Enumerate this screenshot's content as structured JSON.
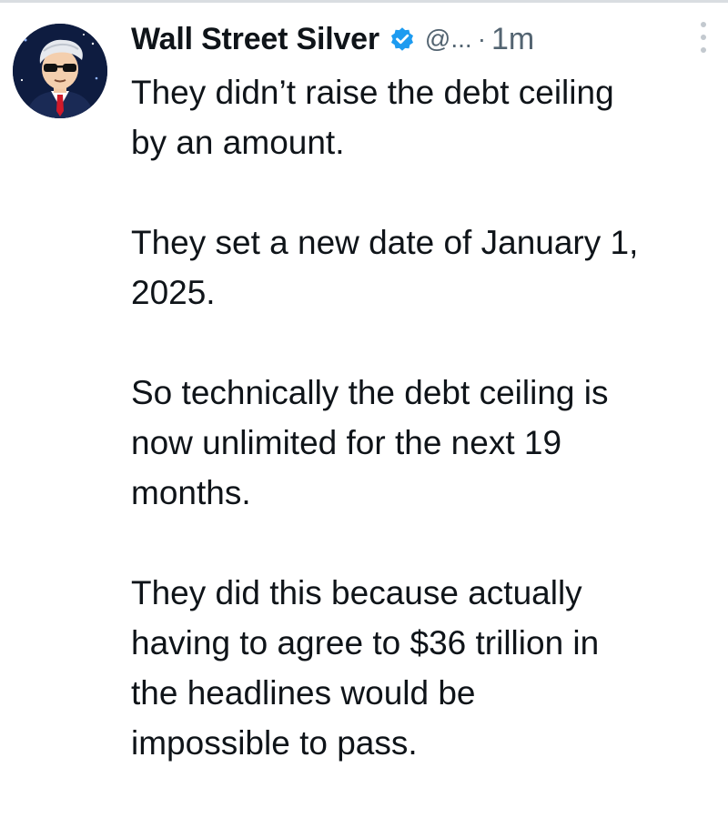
{
  "tweet": {
    "author": {
      "display_name": "Wall Street Silver",
      "handle": "@...",
      "verified": true,
      "avatar_icon": "cartoon-man-sunglasses-avatar"
    },
    "separator": "·",
    "timestamp": "1m",
    "more_icon": "vertical-ellipsis-icon",
    "paragraphs": [
      [
        "They didn’t raise the debt ceiling",
        "by an amount."
      ],
      [
        "They set a new date of January 1,",
        "2025."
      ],
      [
        "So technically the debt ceiling is",
        "now unlimited for the next 19",
        "months."
      ],
      [
        "They did this because actually",
        "having to agree to $36 trillion in",
        "the headlines would be",
        "impossible to pass."
      ]
    ]
  },
  "colors": {
    "text": "#0f1419",
    "muted": "#536471",
    "verified_badge": "#1d9bf0"
  }
}
